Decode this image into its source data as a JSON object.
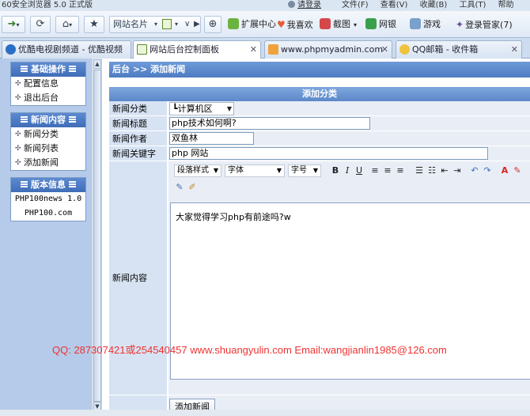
{
  "browser": {
    "app_title": "60安全浏览器 5.0 正式版",
    "login": "请登录",
    "menus": [
      "文件(F)",
      "查看(V)",
      "收藏(B)",
      "工具(T)",
      "帮助(H)"
    ]
  },
  "toolbar": {
    "site_name_label": "网站名片",
    "extension_center": "扩展中心",
    "my_favorites": "我喜欢",
    "screenshot": "截图",
    "online_banking": "网银",
    "games": "游戏",
    "login_manager": "登录管家(7)"
  },
  "tabs": [
    {
      "label": "优酷电视剧频道 - 优酷视频"
    },
    {
      "label": "网站后台控制面板"
    },
    {
      "label": "www.phpmyadmin.com"
    },
    {
      "label": "QQ邮箱 - 收件箱"
    }
  ],
  "sidebar": {
    "sections": [
      {
        "title": "基础操作",
        "items": [
          "配置信息",
          "退出后台"
        ]
      },
      {
        "title": "新闻内容",
        "items": [
          "新闻分类",
          "新闻列表",
          "添加新闻"
        ]
      },
      {
        "title": "版本信息",
        "items": [
          "PHP100news 1.0",
          "PHP100.com"
        ]
      }
    ]
  },
  "breadcrumb": "后台 >> 添加新闻",
  "form": {
    "title": "添加分类",
    "category_label": "新闻分类",
    "category_value": "┗计算机区",
    "title_label": "新闻标题",
    "title_value": "php技术如何啊?",
    "author_label": "新闻作者",
    "author_value": "双鱼林",
    "keywords_label": "新闻关键字",
    "keywords_value": "php 网站",
    "content_label": "新闻内容",
    "content_value": "大家觉得学习php有前途吗?w",
    "submit_label": "添加新闻"
  },
  "editor": {
    "paragraph_style": "段落样式",
    "font": "字体",
    "font_size": "字号"
  },
  "watermark": "QQ: 287307421或254540457 www.shuangyulin.com Email:wangjianlin1985@126.com"
}
